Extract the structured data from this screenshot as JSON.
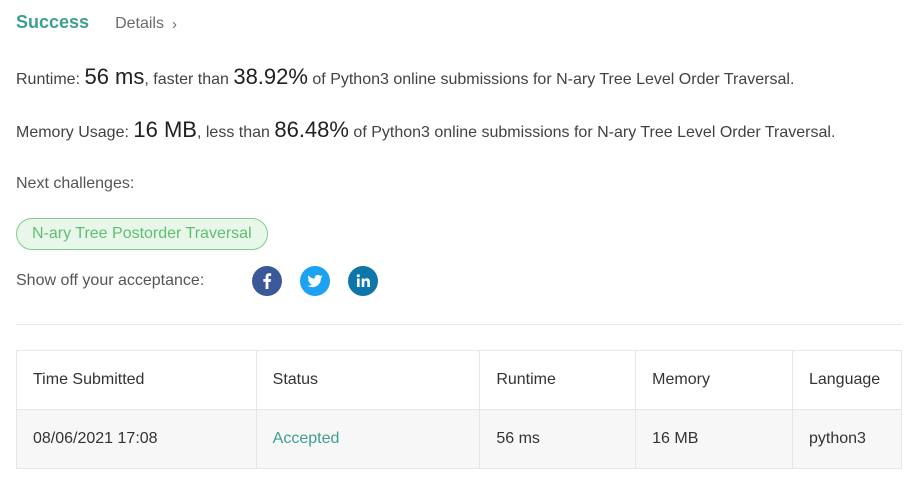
{
  "header": {
    "status": "Success",
    "details_label": "Details",
    "chevron": "›"
  },
  "runtime_line": {
    "label": "Runtime: ",
    "value": "56 ms",
    "mid": ", faster than ",
    "percent": "38.92%",
    "suffix": " of Python3 online submissions for N-ary Tree Level Order Traversal."
  },
  "memory_line": {
    "label": "Memory Usage: ",
    "value": "16 MB",
    "mid": ", less than ",
    "percent": "86.48%",
    "suffix": " of Python3 online submissions for N-ary Tree Level Order Traversal."
  },
  "next": {
    "label": "Next challenges:",
    "challenges": [
      "N-ary Tree Postorder Traversal"
    ]
  },
  "share": {
    "label": "Show off your acceptance:",
    "icons": [
      "facebook-icon",
      "twitter-icon",
      "linkedin-icon"
    ],
    "colors": {
      "facebook": "#3b5998",
      "twitter": "#1da1f2",
      "linkedin": "#0e76a8"
    }
  },
  "table": {
    "headers": [
      "Time Submitted",
      "Status",
      "Runtime",
      "Memory",
      "Language"
    ],
    "rows": [
      {
        "time": "08/06/2021 17:08",
        "status": "Accepted",
        "runtime": "56 ms",
        "memory": "16 MB",
        "language": "python3"
      }
    ]
  },
  "colors": {
    "accent": "#3c9f90",
    "pill_border": "#7bcf8a",
    "pill_bg": "#e8f7ea",
    "pill_text": "#5fbf70"
  }
}
